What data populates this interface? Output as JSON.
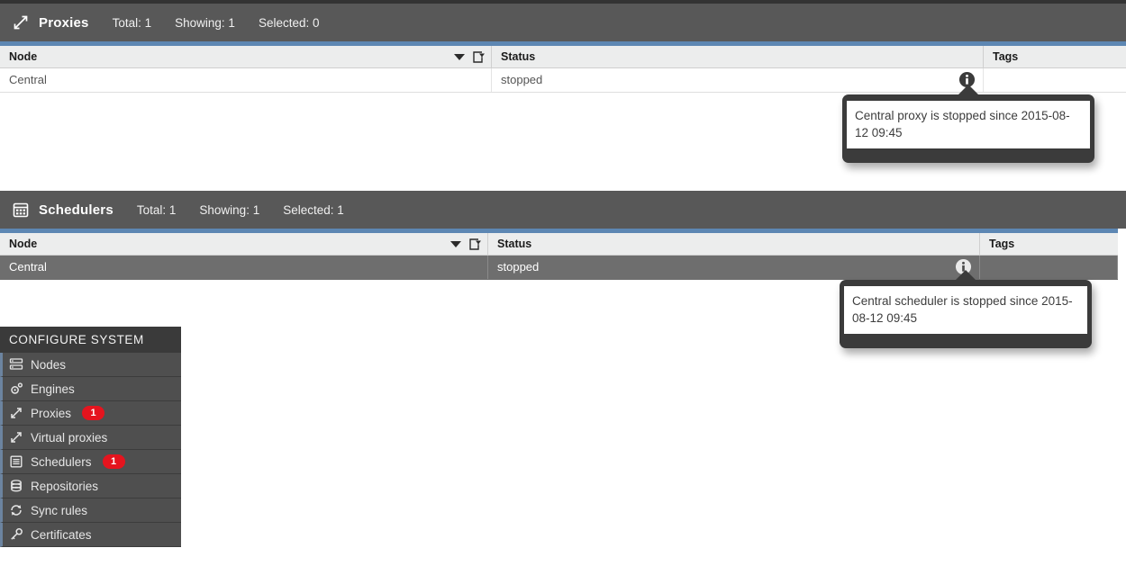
{
  "theme": {
    "header_bg": "#585858",
    "accent_blue": "#5d87b3",
    "badge_red": "#e5141e",
    "selected_row_bg": "#6e6e6e",
    "sidebar_bg": "#4f4f4f"
  },
  "proxies": {
    "icon": "proxies-icon",
    "title": "Proxies",
    "stats": [
      {
        "label": "Total: 1"
      },
      {
        "label": "Showing: 1"
      },
      {
        "label": "Selected: 0"
      }
    ],
    "columns": [
      {
        "label": "Node"
      },
      {
        "label": "Status"
      },
      {
        "label": "Tags"
      }
    ],
    "rows": [
      {
        "node": "Central",
        "status": "stopped",
        "tags": "",
        "selected": false,
        "has_info": true
      }
    ],
    "tooltip": {
      "text": "Central proxy is stopped since 2015-08-12 09:45"
    }
  },
  "schedulers": {
    "icon": "schedulers-icon",
    "title": "Schedulers",
    "stats": [
      {
        "label": "Total: 1"
      },
      {
        "label": "Showing: 1"
      },
      {
        "label": "Selected: 1"
      }
    ],
    "columns": [
      {
        "label": "Node"
      },
      {
        "label": "Status"
      },
      {
        "label": "Tags"
      }
    ],
    "rows": [
      {
        "node": "Central",
        "status": "stopped",
        "tags": "",
        "selected": true,
        "has_info": true
      }
    ],
    "tooltip": {
      "text": "Central scheduler is stopped since 2015-08-12 09:45"
    }
  },
  "sidebar": {
    "title": "CONFIGURE SYSTEM",
    "items": [
      {
        "label": "Nodes",
        "icon": "nodes-icon",
        "badge": ""
      },
      {
        "label": "Engines",
        "icon": "engines-icon",
        "badge": ""
      },
      {
        "label": "Proxies",
        "icon": "proxies-icon",
        "badge": "1"
      },
      {
        "label": "Virtual proxies",
        "icon": "virtual-proxies-icon",
        "badge": ""
      },
      {
        "label": "Schedulers",
        "icon": "schedulers-icon",
        "badge": "1"
      },
      {
        "label": "Repositories",
        "icon": "repositories-icon",
        "badge": ""
      },
      {
        "label": "Sync rules",
        "icon": "sync-rules-icon",
        "badge": ""
      },
      {
        "label": "Certificates",
        "icon": "certificates-icon",
        "badge": ""
      }
    ]
  }
}
